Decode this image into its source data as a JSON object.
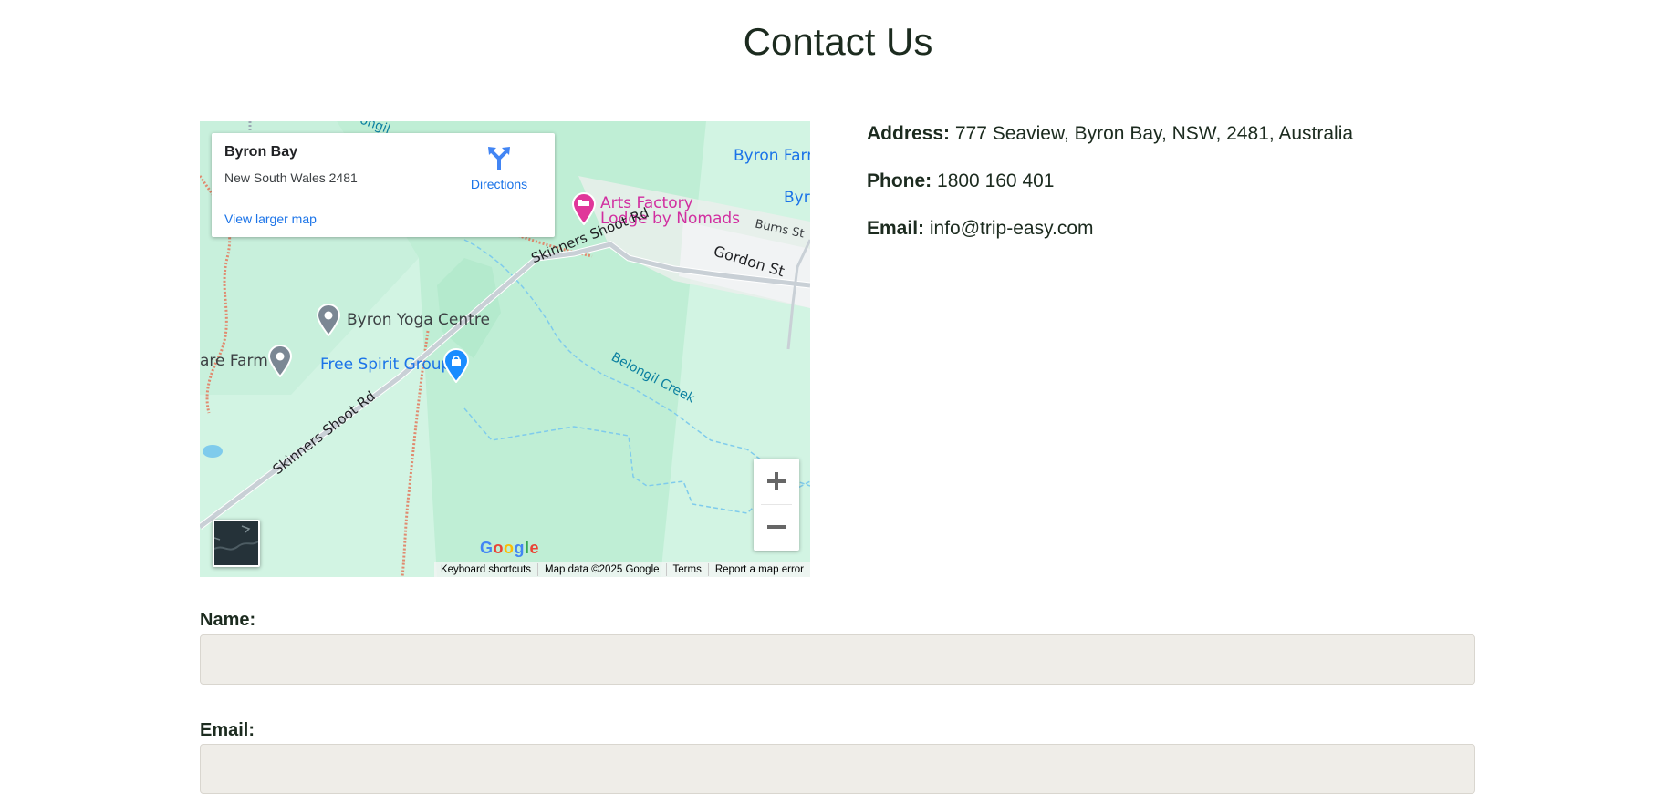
{
  "page": {
    "title": "Contact Us"
  },
  "map": {
    "info_card": {
      "place_name": "Byron Bay",
      "address": "New South Wales 2481",
      "directions_label": "Directions",
      "view_larger_label": "View larger map"
    },
    "labels": {
      "byron_farm": "Byron Farm",
      "byro": "Byro",
      "arts_factory_line1": "Arts Factory",
      "arts_factory_line2": "Lodge by Nomads",
      "burns_st": "Burns St",
      "gordon_st": "Gordon St",
      "skinners_shoot_rd_upper": "Skinners Shoot Rd",
      "skinners_shoot_rd_lower": "Skinners Shoot Rd",
      "byron_yoga_centre": "Byron Yoga Centre",
      "are_farm": "are Farm",
      "free_spirit_group": "Free Spirit Group",
      "belongil_creek": "Belongil Creek",
      "top_fragment": "ongil"
    },
    "google_logo_letters": [
      "G",
      "o",
      "o",
      "g",
      "l",
      "e"
    ],
    "attribution": {
      "keyboard_shortcuts": "Keyboard shortcuts",
      "map_data": "Map data ©2025 Google",
      "terms": "Terms",
      "report": "Report a map error"
    },
    "colors": {
      "land": "#d2f4e3",
      "park": "#bfeed5",
      "road": "#c9d0d6",
      "trail": "#e08a6f",
      "water": "#7fcbec",
      "poi_blue": "#1a73e8",
      "poi_pink": "#d12ea0",
      "poi_gray": "#7b8794"
    }
  },
  "contact": {
    "address_label": "Address:",
    "address_value": "777 Seaview, Byron Bay, NSW, 2481, Australia",
    "phone_label": "Phone:",
    "phone_value": "1800 160 401",
    "email_label": "Email:",
    "email_value": "info@trip-easy.com"
  },
  "form": {
    "name_label": "Name:",
    "name_value": "",
    "email_label": "Email:",
    "email_value": ""
  }
}
